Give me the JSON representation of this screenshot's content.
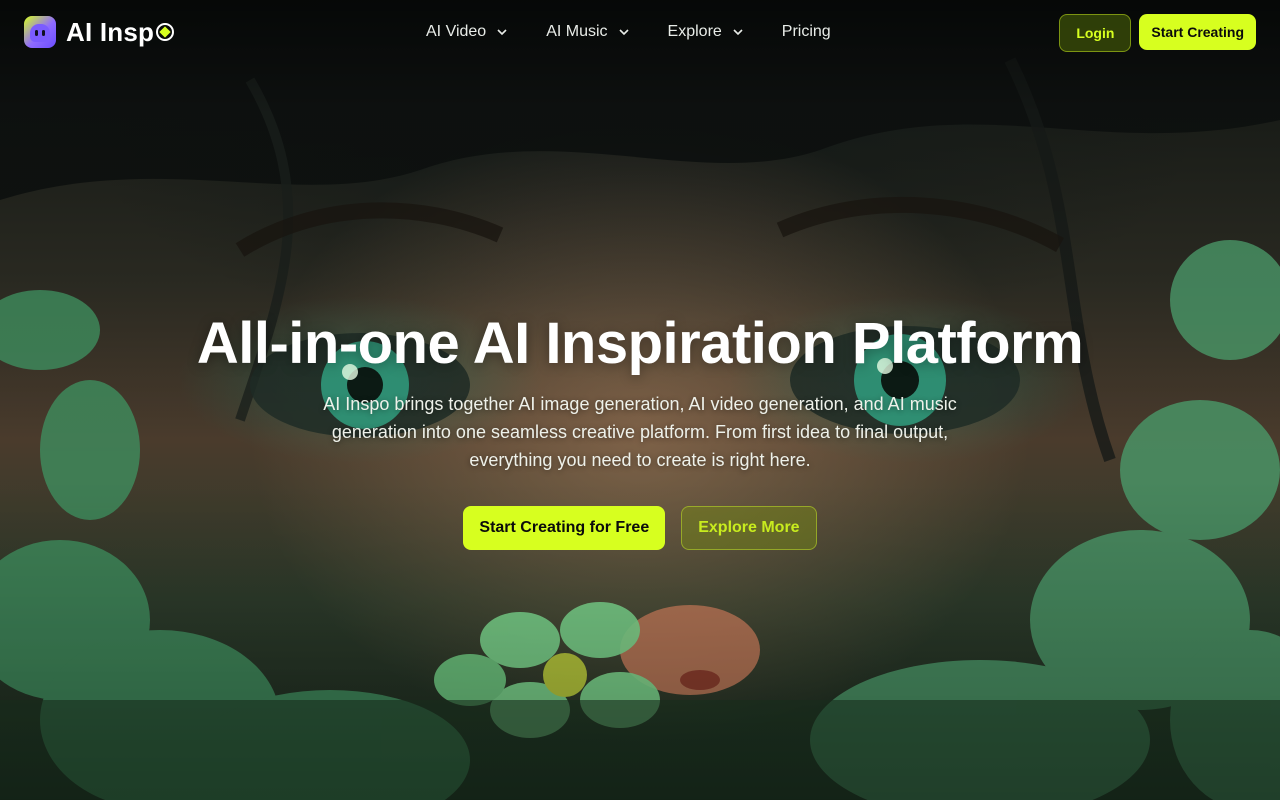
{
  "brand": {
    "name": "AI Insp",
    "logo_icon": "ai-inspo-logo-icon",
    "accent": "#d7ff1f"
  },
  "nav": {
    "items": [
      {
        "label": "AI Video",
        "has_dropdown": true
      },
      {
        "label": "AI Music",
        "has_dropdown": true
      },
      {
        "label": "Explore",
        "has_dropdown": true
      },
      {
        "label": "Pricing",
        "has_dropdown": false
      }
    ],
    "login_label": "Login",
    "start_label": "Start Creating"
  },
  "hero": {
    "title": "All-in-one AI Inspiration Platform",
    "subtitle": "AI Inspo brings together AI image generation, AI video generation, and AI music generation into one seamless creative platform. From first idea to final output, everything you need to create is right here.",
    "primary_cta": "Start Creating for Free",
    "secondary_cta": "Explore More"
  }
}
